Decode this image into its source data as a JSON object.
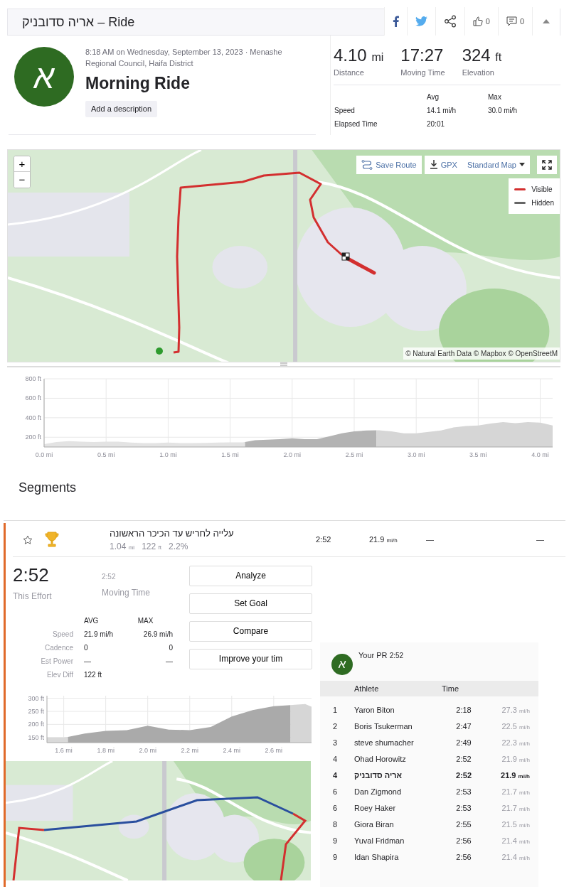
{
  "header": {
    "title": "אריה סדובניק – Ride",
    "actions": [
      {
        "kind": "facebook"
      },
      {
        "kind": "twitter"
      },
      {
        "kind": "share"
      },
      {
        "kind": "kudos",
        "count": "0"
      },
      {
        "kind": "comments",
        "count": "0"
      },
      {
        "kind": "collapse"
      }
    ]
  },
  "activity": {
    "avatar": "א",
    "meta": "8:18 AM on Wednesday, September 13, 2023 · Menashe Regional Council, Haifa District",
    "name": "Morning Ride",
    "description_button": "Add a description"
  },
  "stats": {
    "primary": [
      {
        "value": "4.10",
        "unit": "mi",
        "label": "Distance"
      },
      {
        "value": "17:27",
        "label": "Moving Time"
      },
      {
        "value": "324",
        "unit": "ft",
        "label": "Elevation"
      }
    ],
    "columns": [
      "Avg",
      "Max"
    ],
    "rows": [
      {
        "label": "Speed",
        "avg": "14.1 mi/h",
        "max": "30.0 mi/h"
      },
      {
        "label": "Elapsed Time",
        "avg": "20:01"
      }
    ]
  },
  "map": {
    "kind": "picture",
    "zoom_in": "+",
    "zoom_out": "−",
    "buttons": [
      {
        "kind": "route",
        "label": "Save Route"
      },
      {
        "kind": "download",
        "label": "GPX"
      },
      {
        "kind": "dropdown",
        "label": "Standard Map"
      },
      {
        "kind": "fullscreen"
      }
    ],
    "legend": [
      {
        "label": "Visible",
        "color": "#d32f2f"
      },
      {
        "label": "Hidden",
        "color": "#666666"
      }
    ],
    "attribution": "© Natural Earth Data © Mapbox © OpenStreetM"
  },
  "elevation": {
    "chart_data": {
      "type": "area",
      "grid": true,
      "x": [
        0,
        0.1,
        0.2,
        0.3,
        0.4,
        0.5,
        0.6,
        0.7,
        0.8,
        0.9,
        1.0,
        1.1,
        1.2,
        1.3,
        1.4,
        1.5,
        1.6,
        1.62,
        1.7,
        1.8,
        1.9,
        2.0,
        2.1,
        2.2,
        2.3,
        2.4,
        2.5,
        2.6,
        2.68,
        2.7,
        2.8,
        2.9,
        3.0,
        3.1,
        3.2,
        3.3,
        3.4,
        3.5,
        3.6,
        3.7,
        3.8,
        3.9,
        4.0,
        4.1
      ],
      "series": [
        {
          "color": "#e3e3e3",
          "values": [
            130,
            150,
            160,
            155,
            152,
            155,
            155,
            145,
            140,
            140,
            145,
            140,
            140,
            142,
            145,
            147,
            148,
            150,
            null,
            null,
            null,
            null,
            null,
            null,
            null,
            null,
            null,
            null,
            null,
            null,
            null,
            null,
            null,
            null,
            null,
            null,
            null,
            null,
            null,
            null,
            null,
            null,
            null,
            null
          ]
        },
        {
          "color": "#b3b3b3",
          "values": [
            null,
            null,
            null,
            null,
            null,
            null,
            null,
            null,
            null,
            null,
            null,
            null,
            null,
            null,
            null,
            null,
            null,
            150,
            170,
            175,
            180,
            190,
            180,
            180,
            210,
            240,
            260,
            270,
            271,
            null,
            null,
            null,
            null,
            null,
            null,
            null,
            null,
            null,
            null,
            null,
            null,
            null,
            null,
            null
          ]
        },
        {
          "color": "#d6d6d6",
          "values": [
            null,
            null,
            null,
            null,
            null,
            null,
            null,
            null,
            null,
            null,
            null,
            null,
            null,
            null,
            null,
            null,
            null,
            null,
            null,
            null,
            null,
            null,
            null,
            null,
            null,
            null,
            null,
            null,
            271,
            272,
            260,
            240,
            240,
            255,
            270,
            300,
            315,
            320,
            340,
            355,
            345,
            355,
            350,
            320
          ]
        }
      ],
      "xlim": [
        0,
        4.1
      ],
      "ylim": [
        100,
        800
      ],
      "xticks": [
        {
          "value": 0,
          "label": "0.0 mi"
        },
        {
          "value": 0.5,
          "label": "0.5 mi"
        },
        {
          "value": 1,
          "label": "1.0 mi"
        },
        {
          "value": 1.5,
          "label": "1.5 mi"
        },
        {
          "value": 2,
          "label": "2.0 mi"
        },
        {
          "value": 2.5,
          "label": "2.5 mi"
        },
        {
          "value": 3,
          "label": "3.0 mi"
        },
        {
          "value": 3.5,
          "label": "3.5 mi"
        },
        {
          "value": 4,
          "label": "4.0 mi"
        }
      ],
      "yticks": [
        {
          "value": 200,
          "label": "200 ft"
        },
        {
          "value": 400,
          "label": "400 ft"
        },
        {
          "value": 600,
          "label": "600 ft"
        },
        {
          "value": 800,
          "label": "800 ft"
        }
      ]
    }
  },
  "segments": {
    "title": "Segments",
    "rows": [
      {
        "starred": false,
        "name": "עלייה לחריש עד הכיכר הראשונה",
        "distance": "1.04",
        "distance_unit": "mi",
        "elevation": "122",
        "elevation_unit": "ft",
        "grade": "2.2%",
        "time": "2:52",
        "speed": "21.9",
        "speed_unit": "mi/h",
        "column_7": "—",
        "column_8": "—"
      }
    ],
    "effort": {
      "time": "2:52",
      "time_label": "This Effort",
      "moving_time": "2:52",
      "moving_label": "Moving Time",
      "columns": [
        "AVG",
        "MAX"
      ],
      "rows": [
        {
          "label": "Speed",
          "avg": "21.9 mi/h",
          "max": "26.9 mi/h"
        },
        {
          "label": "Cadence",
          "avg": "0",
          "max": "0"
        },
        {
          "label": "Est Power",
          "avg": "—",
          "max": "—"
        },
        {
          "label": "Elev Diff",
          "avg": "122 ft"
        }
      ],
      "buttons": [
        "Analyze",
        "Set Goal",
        "Compare",
        "Improve your tim"
      ],
      "chart_data": {
        "type": "area",
        "grid": true,
        "x": [
          1.52,
          1.6,
          1.62,
          1.7,
          1.8,
          1.9,
          2.0,
          2.1,
          2.2,
          2.3,
          2.4,
          2.5,
          2.6,
          2.68,
          2.7,
          2.75,
          2.78
        ],
        "series": [
          {
            "color": "#d9d9d9",
            "values": [
              150,
              150,
              152,
              null,
              null,
              null,
              null,
              null,
              null,
              null,
              null,
              null,
              null,
              null,
              null,
              null,
              null
            ]
          },
          {
            "color": "#aaaaaa",
            "values": [
              null,
              null,
              152,
              165,
              175,
              178,
              195,
              180,
              178,
              190,
              230,
              255,
              270,
              274,
              null,
              null,
              null
            ]
          },
          {
            "color": "#d6d6d6",
            "values": [
              null,
              null,
              null,
              null,
              null,
              null,
              null,
              null,
              null,
              null,
              null,
              null,
              null,
              274,
              275,
              278,
              268
            ]
          }
        ],
        "xlim": [
          1.52,
          2.78
        ],
        "ylim": [
          130,
          310
        ],
        "xticks": [
          {
            "value": 1.6,
            "label": "1.6 mi"
          },
          {
            "value": 1.8,
            "label": "1.8 mi"
          },
          {
            "value": 2.0,
            "label": "2.0 mi"
          },
          {
            "value": 2.2,
            "label": "2.2 mi"
          },
          {
            "value": 2.4,
            "label": "2.4 mi"
          },
          {
            "value": 2.6,
            "label": "2.6 mi"
          }
        ],
        "yticks": [
          {
            "value": 150,
            "label": "150 ft"
          },
          {
            "value": 200,
            "label": "200 ft"
          },
          {
            "value": 250,
            "label": "250 ft"
          },
          {
            "value": 300,
            "label": "300 ft"
          }
        ]
      },
      "map": {
        "kind": "picture"
      }
    },
    "leaderboard": {
      "avatar": "א",
      "pr_label": "Your PR",
      "pr_time": "2:52",
      "columns": [
        "Athlete",
        "Time"
      ],
      "rows": [
        {
          "rank": "1",
          "athlete": "Yaron Biton",
          "time": "2:18",
          "speed": "27.3",
          "unit": "mi/h",
          "selected": false
        },
        {
          "rank": "2",
          "athlete": "Boris Tsukerman",
          "time": "2:47",
          "speed": "22.5",
          "unit": "mi/h",
          "selected": false
        },
        {
          "rank": "3",
          "athlete": "steve shumacher",
          "time": "2:49",
          "speed": "22.3",
          "unit": "mi/h",
          "selected": false
        },
        {
          "rank": "4",
          "athlete": "Ohad Horowitz",
          "time": "2:52",
          "speed": "21.9",
          "unit": "mi/h",
          "selected": false
        },
        {
          "rank": "4",
          "athlete": "אריה סדובניק",
          "time": "2:52",
          "speed": "21.9",
          "unit": "mi/h",
          "selected": true
        },
        {
          "rank": "6",
          "athlete": "Dan Zigmond",
          "time": "2:53",
          "speed": "21.7",
          "unit": "mi/h",
          "selected": false
        },
        {
          "rank": "6",
          "athlete": "Roey Haker",
          "time": "2:53",
          "speed": "21.7",
          "unit": "mi/h",
          "selected": false
        },
        {
          "rank": "8",
          "athlete": "Giora Biran",
          "time": "2:55",
          "speed": "21.5",
          "unit": "mi/h",
          "selected": false
        },
        {
          "rank": "9",
          "athlete": "Yuval Fridman",
          "time": "2:56",
          "speed": "21.4",
          "unit": "mi/h",
          "selected": false
        },
        {
          "rank": "9",
          "athlete": "Idan Shapira",
          "time": "2:56",
          "speed": "21.4",
          "unit": "mi/h",
          "selected": false
        }
      ]
    }
  }
}
